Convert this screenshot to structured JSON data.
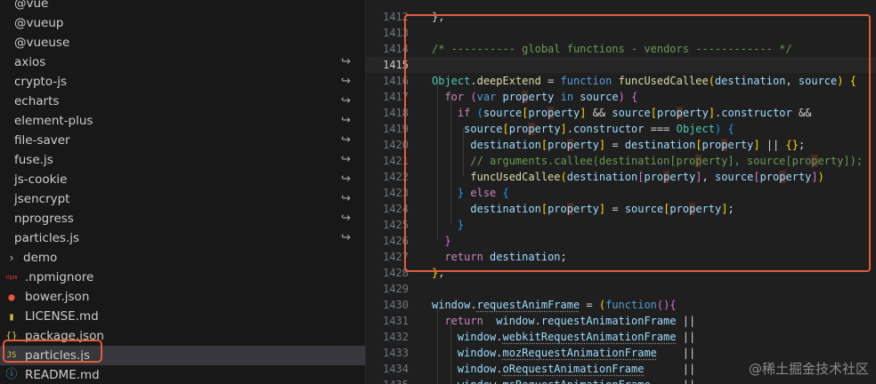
{
  "explorer": {
    "items": [
      {
        "label": "@vue",
        "type": "folder",
        "link": false
      },
      {
        "label": "@vueup",
        "type": "folder",
        "link": false
      },
      {
        "label": "@vueuse",
        "type": "folder",
        "link": false
      },
      {
        "label": "axios",
        "type": "folder",
        "link": true
      },
      {
        "label": "crypto-js",
        "type": "folder",
        "link": true
      },
      {
        "label": "echarts",
        "type": "folder",
        "link": true
      },
      {
        "label": "element-plus",
        "type": "folder",
        "link": true
      },
      {
        "label": "file-saver",
        "type": "folder",
        "link": true
      },
      {
        "label": "fuse.js",
        "type": "folder",
        "link": true
      },
      {
        "label": "js-cookie",
        "type": "folder",
        "link": true
      },
      {
        "label": "jsencrypt",
        "type": "folder",
        "link": true
      },
      {
        "label": "nprogress",
        "type": "folder",
        "link": true
      },
      {
        "label": "particles.js",
        "type": "folder",
        "link": true
      },
      {
        "label": "demo",
        "type": "subfolder",
        "link": false
      },
      {
        "label": ".npmignore",
        "type": "npm",
        "link": false
      },
      {
        "label": "bower.json",
        "type": "bower",
        "link": false
      },
      {
        "label": "LICENSE.md",
        "type": "license",
        "link": false
      },
      {
        "label": "package.json",
        "type": "json",
        "link": false
      },
      {
        "label": "particles.js",
        "type": "js",
        "link": false
      },
      {
        "label": "README.md",
        "type": "info",
        "link": false
      }
    ],
    "selected_index": 18,
    "selected_box_color": "#e35d3a"
  },
  "editor": {
    "line_numbers": [
      "1412",
      "1413",
      "1414",
      "1415",
      "1416",
      "1417",
      "1418",
      "1419",
      "1420",
      "1421",
      "1422",
      "1423",
      "1424",
      "1425",
      "1426",
      "1427",
      "1428",
      "1429",
      "1430",
      "1431",
      "1432",
      "1433",
      "1434",
      "1435"
    ],
    "active_line": "1415",
    "code_box_color": "#e35d3a"
  },
  "watermark": "@稀土掘金技术社区",
  "colors": {
    "keyword": "#569cd6",
    "control": "#c586c0",
    "function": "#dcdcaa",
    "variable": "#9cdcfe",
    "type": "#4ec9b0",
    "comment": "#6a9955"
  }
}
